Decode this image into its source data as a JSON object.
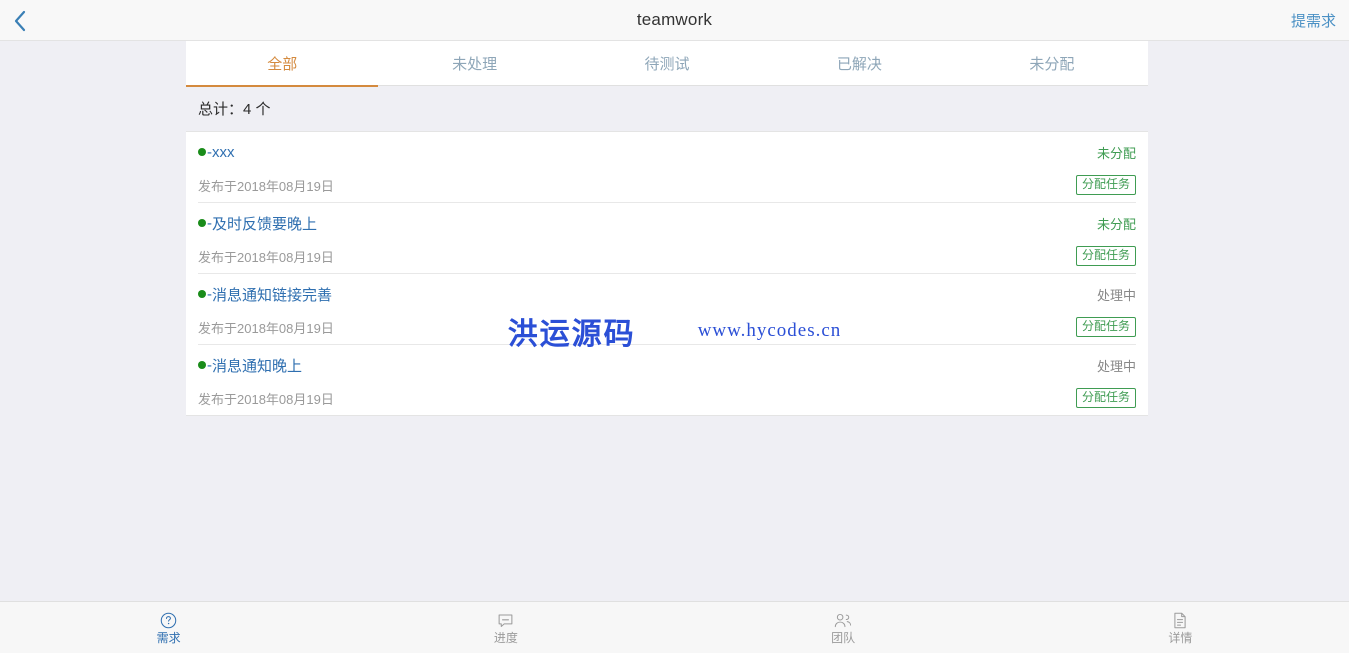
{
  "header": {
    "back_icon": "chevron-left-icon",
    "title": "teamwork",
    "action_label": "提需求",
    "action_color": "#4a90c4"
  },
  "tabs": [
    {
      "label": "全部",
      "active": true
    },
    {
      "label": "未处理",
      "active": false
    },
    {
      "label": "待测试",
      "active": false
    },
    {
      "label": "已解决",
      "active": false
    },
    {
      "label": "未分配",
      "active": false
    }
  ],
  "tab_active_color": "#d48a3e",
  "summary": {
    "total_label": "总计：4 个"
  },
  "list": {
    "dot_color": "#1a8c1a",
    "title_color": "#2f6fb0",
    "assign_label": "分配任务",
    "items": [
      {
        "dot": "green-dot-icon",
        "separator": "-",
        "title": "xxx",
        "status": "未分配",
        "status_type": "unassigned",
        "date": "发布于2018年08月19日",
        "action": "分配任务"
      },
      {
        "dot": "green-dot-icon",
        "separator": "-",
        "title": "及时反馈要晚上",
        "status": "未分配",
        "status_type": "unassigned",
        "date": "发布于2018年08月19日",
        "action": "分配任务"
      },
      {
        "dot": "green-dot-icon",
        "separator": "-",
        "title": "消息通知链接完善",
        "status": "处理中",
        "status_type": "processing",
        "date": "发布于2018年08月19日",
        "action": "分配任务"
      },
      {
        "dot": "green-dot-icon",
        "separator": "-",
        "title": "消息通知晚上",
        "status": "处理中",
        "status_type": "processing",
        "date": "发布于2018年08月19日",
        "action": "分配任务"
      }
    ]
  },
  "watermark": {
    "brand": "洪运源码",
    "url": "www.hycodes.cn",
    "color": "#2b4fd6"
  },
  "bottom_nav": {
    "active_color": "#2f6fb0",
    "items": [
      {
        "label": "需求",
        "icon": "question-circle-icon",
        "active": true
      },
      {
        "label": "进度",
        "icon": "chat-bubble-icon",
        "active": false
      },
      {
        "label": "团队",
        "icon": "people-icon",
        "active": false
      },
      {
        "label": "详情",
        "icon": "document-icon",
        "active": false
      }
    ]
  }
}
